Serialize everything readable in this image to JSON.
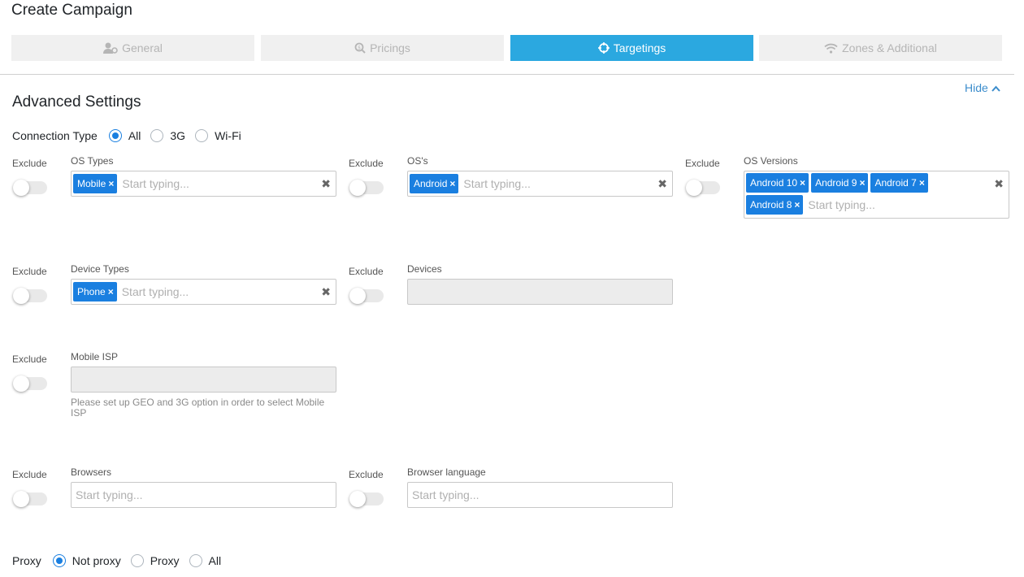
{
  "page": {
    "title": "Create Campaign"
  },
  "steps": [
    {
      "label": "General",
      "icon": "user-gear-icon",
      "active": false
    },
    {
      "label": "Pricings",
      "icon": "search-dollar-icon",
      "active": false
    },
    {
      "label": "Targetings",
      "icon": "crosshairs-icon",
      "active": true
    },
    {
      "label": "Zones & Additional",
      "icon": "wifi-icon",
      "active": false
    }
  ],
  "colors": {
    "accent": "#2ba8e0",
    "tag": "#1a7fe0",
    "link": "#3c8dcc"
  },
  "section": {
    "title": "Advanced Settings",
    "hide_label": "Hide"
  },
  "connection": {
    "label": "Connection Type",
    "options": [
      "All",
      "3G",
      "Wi-Fi"
    ],
    "selected": "All"
  },
  "exclude_label": "Exclude",
  "fields": {
    "os_types": {
      "label": "OS Types",
      "tags": [
        "Mobile"
      ],
      "placeholder": "Start typing..."
    },
    "oss": {
      "label": "OS's",
      "tags": [
        "Android"
      ],
      "placeholder": "Start typing..."
    },
    "os_versions": {
      "label": "OS Versions",
      "tags": [
        "Android 10",
        "Android 9",
        "Android 7",
        "Android 8"
      ],
      "placeholder": "Start typing..."
    },
    "device_types": {
      "label": "Device Types",
      "tags": [
        "Phone"
      ],
      "placeholder": "Start typing..."
    },
    "devices": {
      "label": "Devices"
    },
    "mobile_isp": {
      "label": "Mobile ISP",
      "help": "Please set up GEO and 3G option in order to select Mobile ISP"
    },
    "browsers": {
      "label": "Browsers",
      "placeholder": "Start typing..."
    },
    "browser_language": {
      "label": "Browser language",
      "placeholder": "Start typing..."
    }
  },
  "proxy": {
    "label": "Proxy",
    "options": [
      "Not proxy",
      "Proxy",
      "All"
    ],
    "selected": "Not proxy"
  }
}
